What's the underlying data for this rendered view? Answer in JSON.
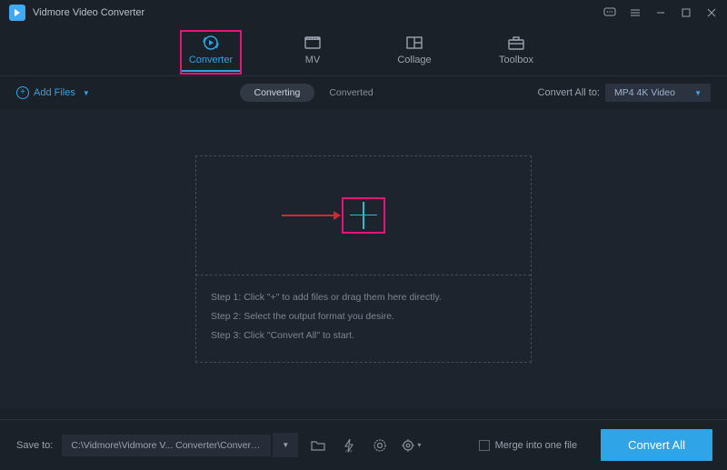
{
  "titlebar": {
    "app_title": "Vidmore Video Converter"
  },
  "tabs": {
    "converter": "Converter",
    "mv": "MV",
    "collage": "Collage",
    "toolbox": "Toolbox"
  },
  "subbar": {
    "add_files": "Add Files",
    "converting": "Converting",
    "converted": "Converted",
    "convert_all_to_label": "Convert All to:",
    "format_selected": "MP4 4K Video"
  },
  "steps": {
    "s1": "Step 1: Click \"+\" to add files or drag them here directly.",
    "s2": "Step 2: Select the output format you desire.",
    "s3": "Step 3: Click \"Convert All\" to start."
  },
  "footer": {
    "save_to_label": "Save to:",
    "path": "C:\\Vidmore\\Vidmore V... Converter\\Converted",
    "merge_label": "Merge into one file",
    "convert_button": "Convert All"
  }
}
